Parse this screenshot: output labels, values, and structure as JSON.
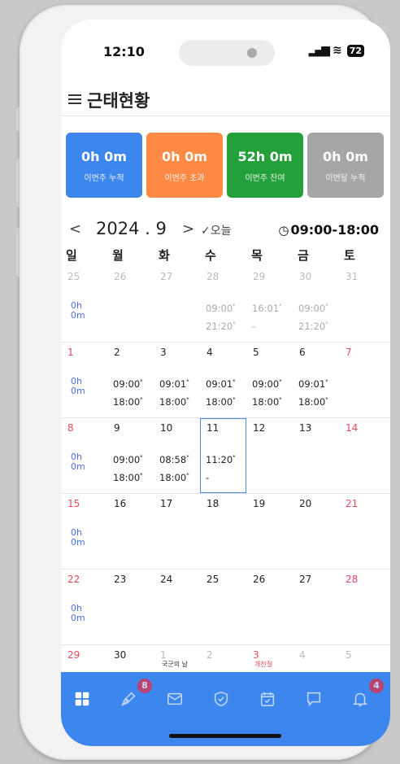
{
  "status": {
    "time": "12:10",
    "battery": "72"
  },
  "header": {
    "title": "근태현황"
  },
  "summary": [
    {
      "value": "0h 0m",
      "label": "이번주 누적",
      "color": "#3d86ee"
    },
    {
      "value": "0h 0m",
      "label": "이번주 초과",
      "color": "#ff8a45"
    },
    {
      "value": "52h 0m",
      "label": "이번주 잔여",
      "color": "#23a03a"
    },
    {
      "value": "0h 0m",
      "label": "이번달 누적",
      "color": "#a6a6a6"
    }
  ],
  "month_nav": {
    "prev": "<",
    "month": "2024 . 9",
    "next": ">",
    "today": "✓오늘",
    "hours": "09:00-18:00"
  },
  "weekdays": [
    "일",
    "월",
    "화",
    "수",
    "목",
    "금",
    "토"
  ],
  "weeks": [
    {
      "days": [
        {
          "d": "25",
          "dim": true,
          "acc": "0h\n0m"
        },
        {
          "d": "26",
          "dim": true
        },
        {
          "d": "27",
          "dim": true
        },
        {
          "d": "28",
          "dim": true,
          "t1": "09:00",
          "t2": "21:20"
        },
        {
          "d": "29",
          "dim": true,
          "t1": "16:01",
          "t2": "-"
        },
        {
          "d": "30",
          "dim": true,
          "t1": "09:00",
          "t2": "21:20"
        },
        {
          "d": "31",
          "dim": true
        }
      ]
    },
    {
      "days": [
        {
          "d": "1",
          "red": true,
          "acc": "0h\n0m"
        },
        {
          "d": "2",
          "t1": "09:00",
          "t2": "18:00"
        },
        {
          "d": "3",
          "t1": "09:01",
          "t2": "18:00"
        },
        {
          "d": "4",
          "t1": "09:01",
          "t2": "18:00"
        },
        {
          "d": "5",
          "t1": "09:00",
          "t2": "18:00"
        },
        {
          "d": "6",
          "t1": "09:01",
          "t2": "18:00"
        },
        {
          "d": "7",
          "red": true
        }
      ]
    },
    {
      "days": [
        {
          "d": "8",
          "red": true,
          "acc": "0h\n0m"
        },
        {
          "d": "9",
          "t1": "09:00",
          "t2": "18:00"
        },
        {
          "d": "10",
          "t1": "08:58",
          "t2": "18:00"
        },
        {
          "d": "11",
          "sel": true,
          "t1": "11:20",
          "t2": "-"
        },
        {
          "d": "12"
        },
        {
          "d": "13"
        },
        {
          "d": "14",
          "red": true
        }
      ]
    },
    {
      "days": [
        {
          "d": "15",
          "red": true,
          "acc": "0h\n0m"
        },
        {
          "d": "16"
        },
        {
          "d": "17"
        },
        {
          "d": "18"
        },
        {
          "d": "19"
        },
        {
          "d": "20"
        },
        {
          "d": "21",
          "red": true
        }
      ]
    },
    {
      "days": [
        {
          "d": "22",
          "red": true,
          "acc": "0h\n0m"
        },
        {
          "d": "23"
        },
        {
          "d": "24"
        },
        {
          "d": "25"
        },
        {
          "d": "26"
        },
        {
          "d": "27"
        },
        {
          "d": "28",
          "red": true
        }
      ]
    },
    {
      "days": [
        {
          "d": "29",
          "red": true
        },
        {
          "d": "30"
        },
        {
          "d": "1",
          "dim": true,
          "hol": "국군의 날"
        },
        {
          "d": "2",
          "dim": true
        },
        {
          "d": "3",
          "red": true,
          "hol": "개천절",
          "holred": true
        },
        {
          "d": "4",
          "dim": true
        },
        {
          "d": "5",
          "dim": true
        }
      ]
    }
  ],
  "tabs": [
    {
      "icon": "grid-icon",
      "badge": ""
    },
    {
      "icon": "pen-icon",
      "badge": "8"
    },
    {
      "icon": "mail-icon",
      "badge": ""
    },
    {
      "icon": "shield-icon",
      "badge": ""
    },
    {
      "icon": "calendar-check-icon",
      "badge": ""
    },
    {
      "icon": "chat-icon",
      "badge": ""
    },
    {
      "icon": "bell-icon",
      "badge": "4"
    }
  ]
}
